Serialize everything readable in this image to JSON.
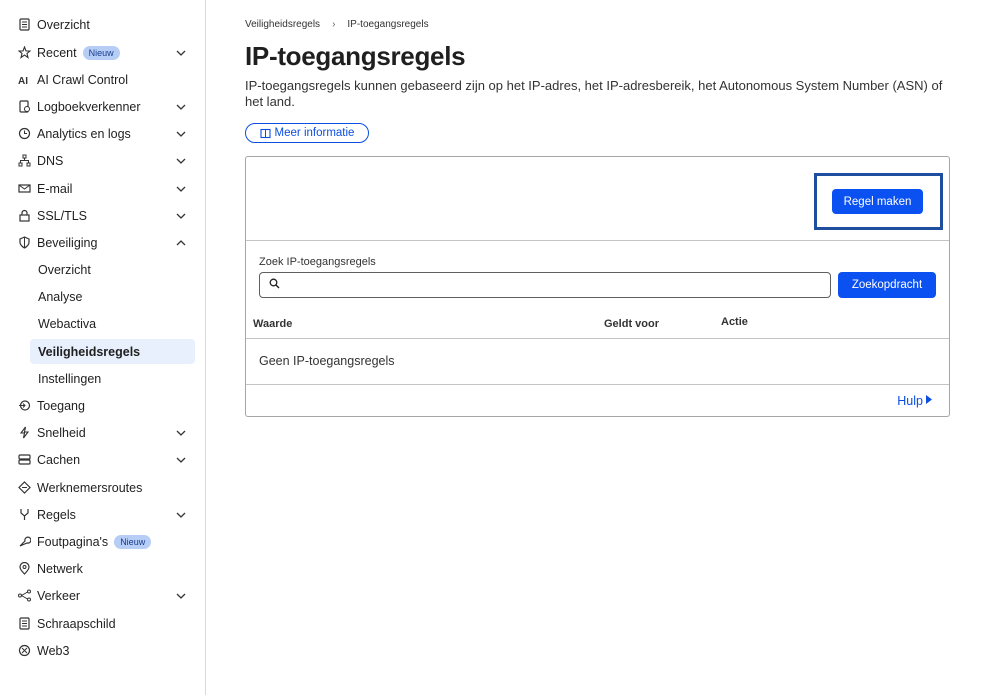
{
  "sidebar": {
    "items": [
      {
        "label": "Overzicht",
        "icon": "document-icon"
      },
      {
        "label": "Recent",
        "icon": "star-icon",
        "badge": "Nieuw",
        "chevron": "down"
      },
      {
        "label": "AI Crawl Control",
        "icon": "ai-icon"
      },
      {
        "label": "Logboekverkenner",
        "icon": "log-icon",
        "chevron": "down"
      },
      {
        "label": "Analytics en logs",
        "icon": "clock-icon",
        "chevron": "down"
      },
      {
        "label": "DNS",
        "icon": "network-icon",
        "chevron": "down"
      },
      {
        "label": "E-mail",
        "icon": "mail-icon",
        "chevron": "down"
      },
      {
        "label": "SSL/TLS",
        "icon": "lock-icon",
        "chevron": "down"
      },
      {
        "label": "Beveiliging",
        "icon": "shield-icon",
        "chevron": "up"
      },
      {
        "label": "Toegang",
        "icon": "access-icon"
      },
      {
        "label": "Snelheid",
        "icon": "lightning-icon",
        "chevron": "down"
      },
      {
        "label": "Cachen",
        "icon": "storage-icon",
        "chevron": "down"
      },
      {
        "label": "Werknemersroutes",
        "icon": "routes-icon"
      },
      {
        "label": "Regels",
        "icon": "fork-icon",
        "chevron": "down"
      },
      {
        "label": "Foutpagina's",
        "icon": "wrench-icon",
        "badge": "Nieuw"
      },
      {
        "label": "Netwerk",
        "icon": "location-icon"
      },
      {
        "label": "Verkeer",
        "icon": "traffic-icon",
        "chevron": "down"
      },
      {
        "label": "Schraapschild",
        "icon": "document-icon"
      },
      {
        "label": "Web3",
        "icon": "web3-icon"
      }
    ],
    "security_sub": [
      {
        "label": "Overzicht"
      },
      {
        "label": "Analyse"
      },
      {
        "label": "Webactiva"
      },
      {
        "label": "Veiligheidsregels",
        "active": true
      },
      {
        "label": "Instellingen"
      }
    ]
  },
  "breadcrumb": {
    "parent": "Veiligheidsregels",
    "current": "IP-toegangsregels"
  },
  "page": {
    "title": "IP-toegangsregels",
    "description": "IP-toegangsregels kunnen gebaseerd zijn op het IP-adres, het IP-adresbereik, het Autonomous System Number (ASN) of het land.",
    "more_info": "Meer informatie"
  },
  "card": {
    "create_button": "Regel maken",
    "search_label": "Zoek IP-toegangsregels",
    "search_value": "",
    "search_button": "Zoekopdracht",
    "columns": [
      "Waarde",
      "Geldt voor",
      "Actie"
    ],
    "empty_text": "Geen IP-toegangsregels",
    "help_link": "Hulp"
  },
  "colors": {
    "accent": "#0b50f0",
    "highlight": "#1f4e9e",
    "active_bg": "#e8f0fd",
    "badge_bg": "#b6cdf5"
  }
}
